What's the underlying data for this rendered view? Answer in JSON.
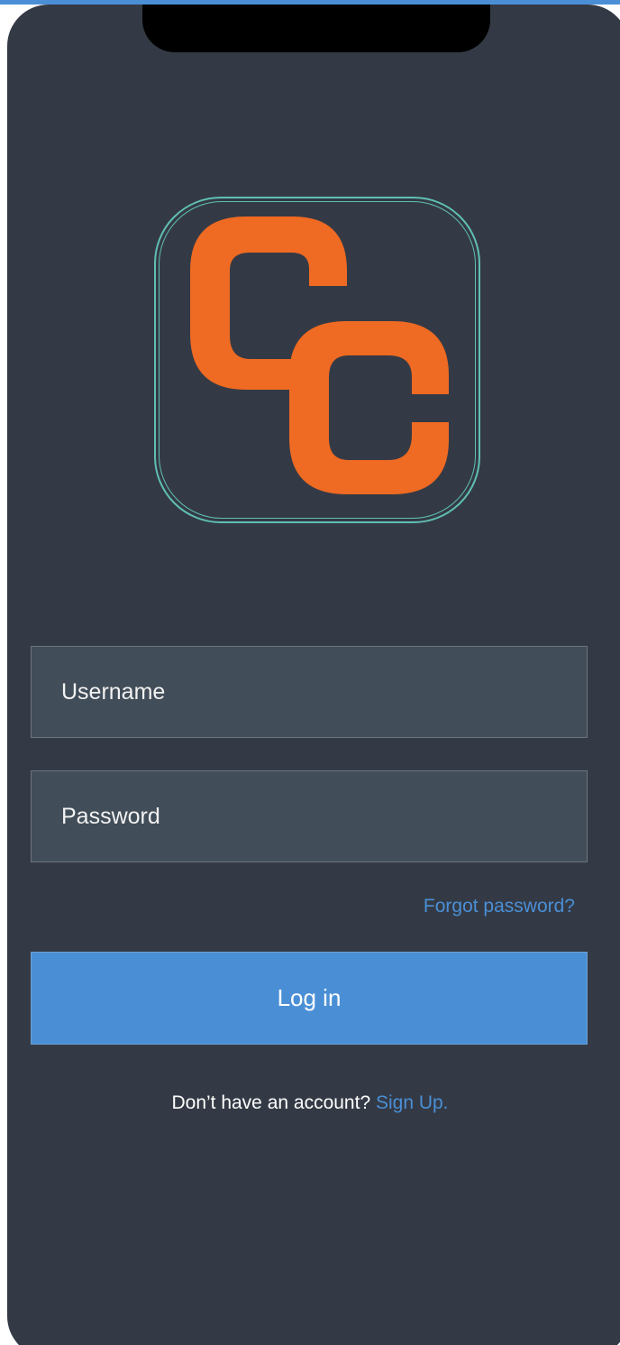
{
  "app": {
    "logo_name": "cc-logo",
    "colors": {
      "background": "#343a45",
      "field_background": "#414d58",
      "accent": "#4a8fd6",
      "logo_orange": "#ef6a22",
      "logo_border": "#5fbfb3"
    }
  },
  "form": {
    "username_placeholder": "Username",
    "password_placeholder": "Password",
    "forgot_label": "Forgot password?",
    "login_label": "Log in"
  },
  "footer": {
    "prompt": "Don’t have an account?",
    "signup_label": "Sign Up."
  }
}
